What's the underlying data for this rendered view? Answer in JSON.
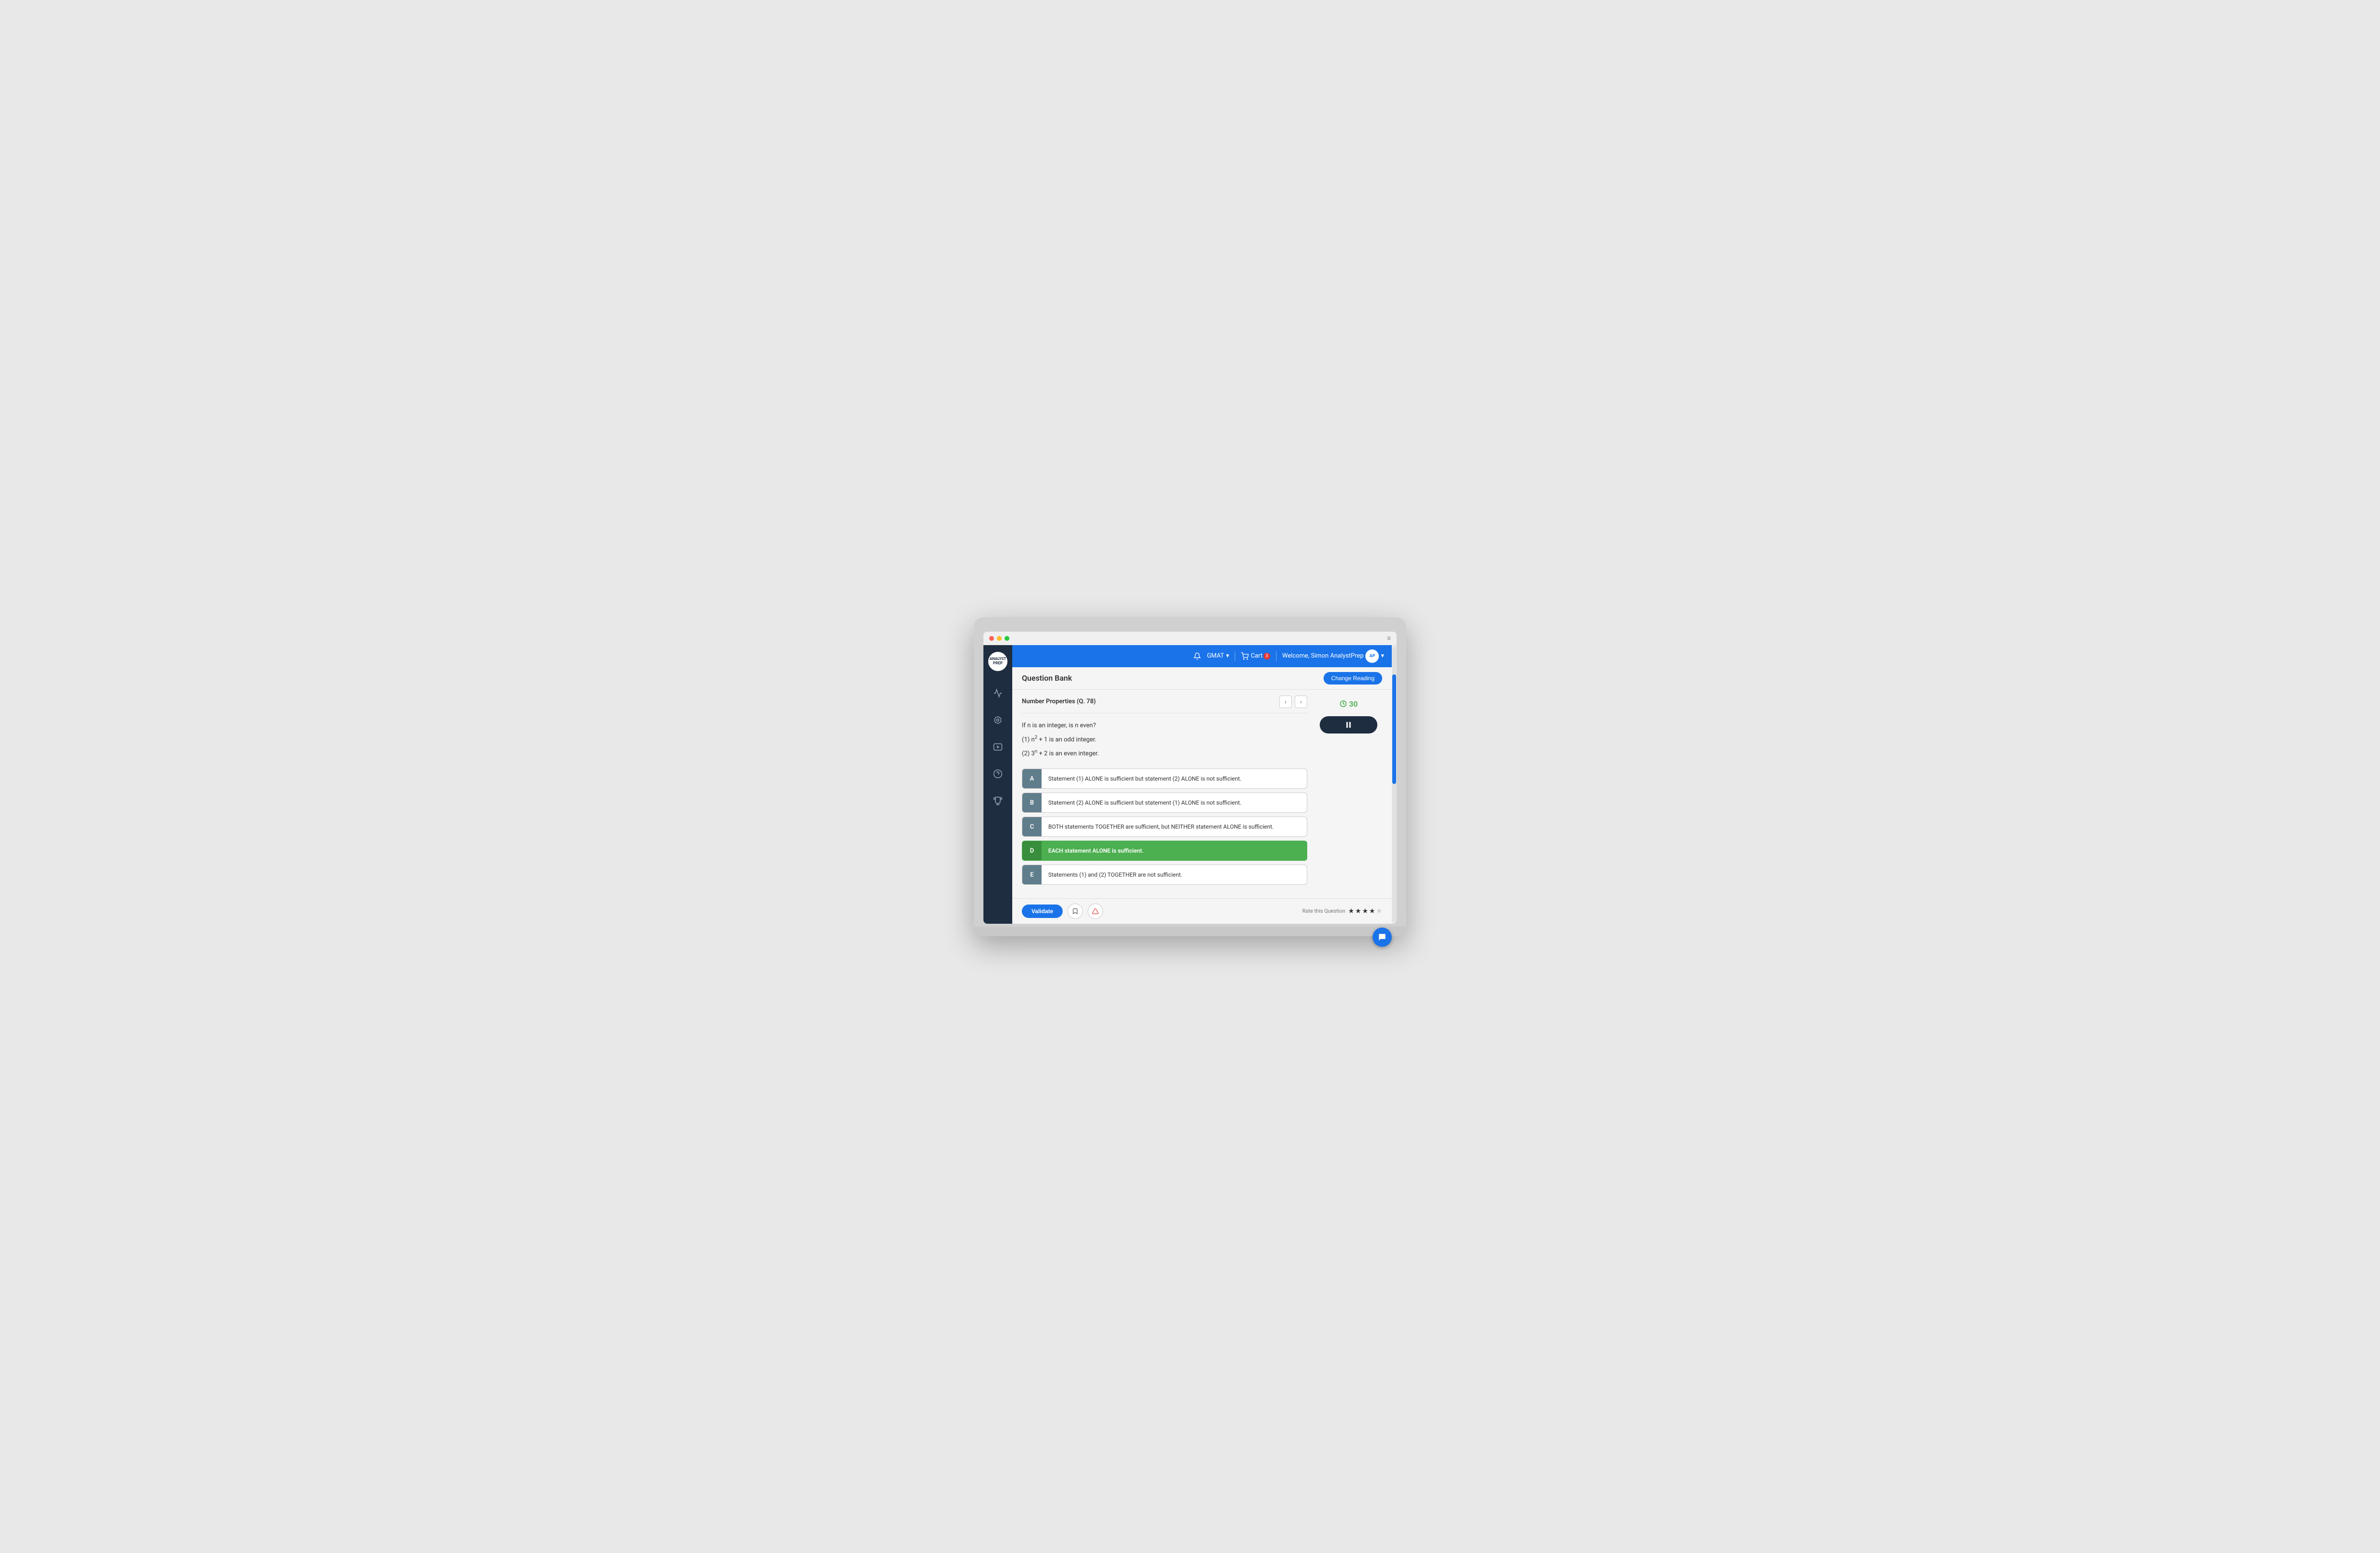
{
  "window": {
    "dots": [
      "red",
      "yellow",
      "green"
    ]
  },
  "topnav": {
    "gmat_label": "GMAT",
    "cart_label": "Cart",
    "cart_count": "3",
    "welcome_label": "Welcome, Simon AnalystPrep"
  },
  "header": {
    "title": "Question Bank",
    "change_reading_btn": "Change Reading"
  },
  "question": {
    "section_label": "Number Properties (Q. 78)",
    "question_text": "If n is an integer, is n even?",
    "statement1": "(1) n² + 1 is an odd integer.",
    "statement2": "(2) 3ⁿ + 2 is an even integer.",
    "timer_value": "30",
    "options": [
      {
        "key": "A",
        "text": "Statement (1) ALONE is sufficient but statement (2) ALONE is not sufficient.",
        "selected": false
      },
      {
        "key": "B",
        "text": "Statement (2) ALONE is sufficient but statement (1) ALONE is not sufficient.",
        "selected": false
      },
      {
        "key": "C",
        "text": "BOTH statements TOGETHER are sufficient, but NEITHER statement ALONE is sufficient.",
        "selected": false
      },
      {
        "key": "D",
        "text": "EACH statement ALONE is sufficient.",
        "selected": true
      },
      {
        "key": "E",
        "text": "Statements (1) and (2) TOGETHER are not sufficient.",
        "selected": false
      }
    ]
  },
  "footer": {
    "validate_label": "Validate",
    "rate_label": "Rate this Question"
  },
  "sidebar": {
    "icons": [
      {
        "name": "chart-icon",
        "symbol": "📊"
      },
      {
        "name": "brain-icon",
        "symbol": "🧠"
      },
      {
        "name": "video-icon",
        "symbol": "▶"
      },
      {
        "name": "help-icon",
        "symbol": "❓"
      },
      {
        "name": "trophy-icon",
        "symbol": "🏆"
      }
    ]
  }
}
